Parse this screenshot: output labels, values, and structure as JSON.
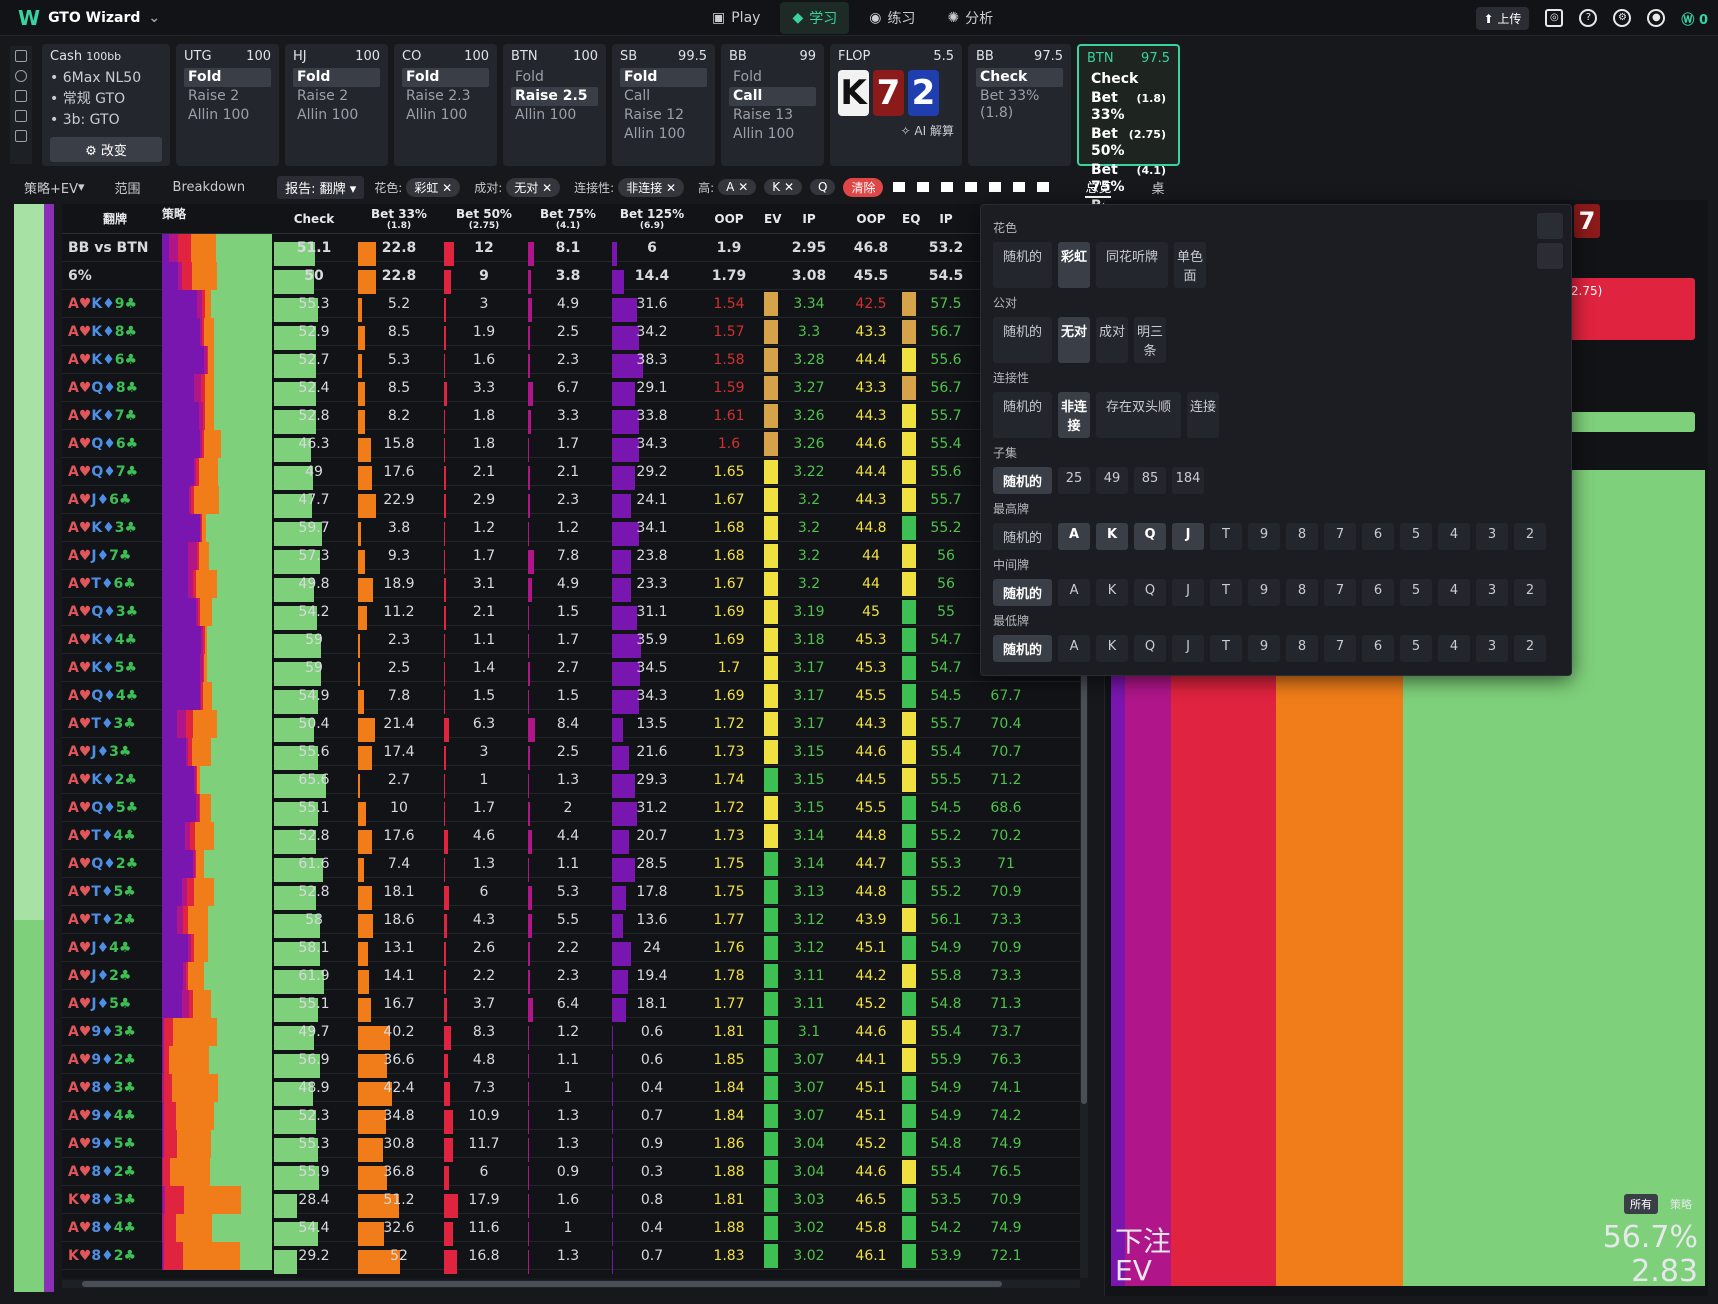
{
  "app": {
    "title": "GTO Wizard"
  },
  "nav": {
    "items": [
      {
        "label": "Play",
        "icon": "cards-icon"
      },
      {
        "label": "学习",
        "icon": "grad-cap-icon",
        "active": true
      },
      {
        "label": "练习",
        "icon": "gamepad-icon"
      },
      {
        "label": "分析",
        "icon": "bulb-icon"
      }
    ]
  },
  "topright": {
    "upload": "上传",
    "coins": "0"
  },
  "positions": [
    {
      "name": "UTG",
      "stack": "100",
      "actions": [
        "Fold",
        "Raise 2",
        "Allin 100"
      ],
      "sel": 0
    },
    {
      "name": "HJ",
      "stack": "100",
      "actions": [
        "Fold",
        "Raise 2",
        "Allin 100"
      ],
      "sel": 0
    },
    {
      "name": "CO",
      "stack": "100",
      "actions": [
        "Fold",
        "Raise 2.3",
        "Allin 100"
      ],
      "sel": 0
    },
    {
      "name": "BTN",
      "stack": "100",
      "actions": [
        "Fold",
        "Raise 2.5",
        "Allin 100"
      ],
      "sel": 1
    },
    {
      "name": "SB",
      "stack": "99.5",
      "actions": [
        "Fold",
        "Call",
        "Raise 12",
        "Allin 100"
      ],
      "sel": 0
    },
    {
      "name": "BB",
      "stack": "99",
      "actions": [
        "Fold",
        "Call",
        "Raise 13",
        "Allin 100"
      ],
      "sel": 1
    }
  ],
  "cash": {
    "title": "Cash",
    "bb": "100bb",
    "lines": [
      "6Max NL50",
      "常规 GTO",
      "3b: GTO"
    ],
    "change": "改变"
  },
  "flop": {
    "label": "FLOP",
    "pot": "5.5",
    "cards": [
      {
        "r": "K",
        "color": "#1a1a1a"
      },
      {
        "r": "7",
        "color": "#8b1a1a"
      },
      {
        "r": "2",
        "color": "#1f3fb0"
      }
    ],
    "ai": "AI 解算"
  },
  "bbcard": {
    "name": "BB",
    "stack": "97.5",
    "actions": [
      "Check",
      "Bet 33%  (1.8)"
    ]
  },
  "btncard": {
    "name": "BTN",
    "stack": "97.5",
    "actions": [
      [
        "Check",
        ""
      ],
      [
        "Bet 33%",
        "(1.8)"
      ],
      [
        "Bet 50%",
        "(2.75)"
      ],
      [
        "Bet 75%",
        "(4.1)"
      ],
      [
        "Bet 125%",
        "(6.9)"
      ]
    ]
  },
  "subbar": {
    "strategy": "策略+EV",
    "range": "范围",
    "breakdown": "Breakdown",
    "report": "报告: 翻牌",
    "suit_label": "花色:",
    "suit_val": "彩虹",
    "pair_label": "成对:",
    "pair_val": "无对",
    "conn_label": "连接性:",
    "conn_val": "非连接",
    "high_label": "高:",
    "high_a": "A",
    "high_k": "K",
    "high_q": "Q",
    "clear": "清除",
    "overview": "总览",
    "table": "桌"
  },
  "table": {
    "headers": [
      "翻牌",
      "策略",
      "Check",
      "Bet 33%",
      "Bet 50%",
      "Bet 75%",
      "Bet 125%",
      "OOP",
      "EV",
      "IP",
      "OOP",
      "EQ",
      "IP"
    ],
    "subheaders": {
      "b33": "(1.8)",
      "b50": "(2.75)",
      "b75": "(4.1)",
      "b125": "(6.9)"
    },
    "summary": [
      {
        "flop": "BB vs BTN",
        "check": "51.1",
        "b33": "22.8",
        "b50": "12",
        "b75": "8.1",
        "b125": "6",
        "oop": "1.9",
        "ip": "2.95",
        "eqoop": "46.8",
        "eqip": "53.2"
      },
      {
        "flop": "6%",
        "check": "50",
        "b33": "22.8",
        "b50": "9",
        "b75": "3.8",
        "b125": "14.4",
        "oop": "1.79",
        "ip": "3.08",
        "eqoop": "45.5",
        "eqip": "54.5"
      }
    ],
    "rows": [
      [
        "A♥K♦9♣",
        "55.3",
        "5.2",
        "3",
        "4.9",
        "31.6",
        "1.54",
        "3.34",
        "42.5",
        "57.5",
        ""
      ],
      [
        "A♥K♦8♣",
        "52.9",
        "8.5",
        "1.9",
        "2.5",
        "34.2",
        "1.57",
        "3.3",
        "43.3",
        "56.7",
        ""
      ],
      [
        "A♥K♦6♣",
        "52.7",
        "5.3",
        "1.6",
        "2.3",
        "38.3",
        "1.58",
        "3.28",
        "44.4",
        "55.6",
        ""
      ],
      [
        "A♥Q♦8♣",
        "52.4",
        "8.5",
        "3.3",
        "6.7",
        "29.1",
        "1.59",
        "3.27",
        "43.3",
        "56.7",
        ""
      ],
      [
        "A♥K♦7♣",
        "52.8",
        "8.2",
        "1.8",
        "3.3",
        "33.8",
        "1.61",
        "3.26",
        "44.3",
        "55.7",
        ""
      ],
      [
        "A♥Q♦6♣",
        "46.3",
        "15.8",
        "1.8",
        "1.7",
        "34.3",
        "1.6",
        "3.26",
        "44.6",
        "55.4",
        ""
      ],
      [
        "A♥Q♦7♣",
        "49",
        "17.6",
        "2.1",
        "2.1",
        "29.2",
        "1.65",
        "3.22",
        "44.4",
        "55.6",
        ""
      ],
      [
        "A♥J♦6♣",
        "47.7",
        "22.9",
        "2.9",
        "2.3",
        "24.1",
        "1.67",
        "3.2",
        "44.3",
        "55.7",
        ""
      ],
      [
        "A♥K♦3♣",
        "59.7",
        "3.8",
        "1.2",
        "1.2",
        "34.1",
        "1.68",
        "3.2",
        "44.8",
        "55.2",
        ""
      ],
      [
        "A♥J♦7♣",
        "57.3",
        "9.3",
        "1.7",
        "7.8",
        "23.8",
        "1.68",
        "3.2",
        "44",
        "56",
        ""
      ],
      [
        "A♥T♦6♣",
        "49.8",
        "18.9",
        "3.1",
        "4.9",
        "23.3",
        "1.67",
        "3.2",
        "44",
        "56",
        ""
      ],
      [
        "A♥Q♦3♣",
        "54.2",
        "11.2",
        "2.1",
        "1.5",
        "31.1",
        "1.69",
        "3.19",
        "45",
        "55",
        ""
      ],
      [
        "A♥K♦4♣",
        "59",
        "2.3",
        "1.1",
        "1.7",
        "35.9",
        "1.69",
        "3.18",
        "45.3",
        "54.7",
        ""
      ],
      [
        "A♥K♦5♣",
        "59",
        "2.5",
        "1.4",
        "2.7",
        "34.5",
        "1.7",
        "3.17",
        "45.3",
        "54.7",
        ""
      ],
      [
        "A♥Q♦4♣",
        "54.9",
        "7.8",
        "1.5",
        "1.5",
        "34.3",
        "1.69",
        "3.17",
        "45.5",
        "54.5",
        "67.7"
      ],
      [
        "A♥T♦3♣",
        "50.4",
        "21.4",
        "6.3",
        "8.4",
        "13.5",
        "1.72",
        "3.17",
        "44.3",
        "55.7",
        "70.4"
      ],
      [
        "A♥J♦3♣",
        "55.6",
        "17.4",
        "3",
        "2.5",
        "21.6",
        "1.73",
        "3.15",
        "44.6",
        "55.4",
        "70.7"
      ],
      [
        "A♥K♦2♣",
        "65.6",
        "2.7",
        "1",
        "1.3",
        "29.3",
        "1.74",
        "3.15",
        "44.5",
        "55.5",
        "71.2"
      ],
      [
        "A♥Q♦5♣",
        "55.1",
        "10",
        "1.7",
        "2",
        "31.2",
        "1.72",
        "3.15",
        "45.5",
        "54.5",
        "68.6"
      ],
      [
        "A♥T♦4♣",
        "52.8",
        "17.6",
        "4.6",
        "4.4",
        "20.7",
        "1.73",
        "3.14",
        "44.8",
        "55.2",
        "70.2"
      ],
      [
        "A♥Q♦2♣",
        "61.6",
        "7.4",
        "1.3",
        "1.1",
        "28.5",
        "1.75",
        "3.14",
        "44.7",
        "55.3",
        "71"
      ],
      [
        "A♥T♦5♣",
        "52.8",
        "18.1",
        "6",
        "5.3",
        "17.8",
        "1.75",
        "3.13",
        "44.8",
        "55.2",
        "70.9"
      ],
      [
        "A♥T♦2♣",
        "58",
        "18.6",
        "4.3",
        "5.5",
        "13.6",
        "1.77",
        "3.12",
        "43.9",
        "56.1",
        "73.3"
      ],
      [
        "A♥J♦4♣",
        "58.1",
        "13.1",
        "2.6",
        "2.2",
        "24",
        "1.76",
        "3.12",
        "45.1",
        "54.9",
        "70.9"
      ],
      [
        "A♥J♦2♣",
        "61.9",
        "14.1",
        "2.2",
        "2.3",
        "19.4",
        "1.78",
        "3.11",
        "44.2",
        "55.8",
        "73.3"
      ],
      [
        "A♥J♦5♣",
        "55.1",
        "16.7",
        "3.7",
        "6.4",
        "18.1",
        "1.77",
        "3.11",
        "45.2",
        "54.8",
        "71.3"
      ],
      [
        "A♥9♦3♣",
        "49.7",
        "40.2",
        "8.3",
        "1.2",
        "0.6",
        "1.81",
        "3.1",
        "44.6",
        "55.4",
        "73.7"
      ],
      [
        "A♥9♦2♣",
        "56.9",
        "36.6",
        "4.8",
        "1.1",
        "0.6",
        "1.85",
        "3.07",
        "44.1",
        "55.9",
        "76.3"
      ],
      [
        "A♥8♦3♣",
        "48.9",
        "42.4",
        "7.3",
        "1",
        "0.4",
        "1.84",
        "3.07",
        "45.1",
        "54.9",
        "74.1"
      ],
      [
        "A♥9♦4♣",
        "52.3",
        "34.8",
        "10.9",
        "1.3",
        "0.7",
        "1.84",
        "3.07",
        "45.1",
        "54.9",
        "74.2"
      ],
      [
        "A♥9♦5♣",
        "55.3",
        "30.8",
        "11.7",
        "1.3",
        "0.9",
        "1.86",
        "3.04",
        "45.2",
        "54.8",
        "74.9"
      ],
      [
        "A♥8♦2♣",
        "55.9",
        "36.8",
        "6",
        "0.9",
        "0.3",
        "1.88",
        "3.04",
        "44.6",
        "55.4",
        "76.5"
      ],
      [
        "K♥8♦3♣",
        "28.4",
        "51.2",
        "17.9",
        "1.6",
        "0.8",
        "1.81",
        "3.03",
        "46.5",
        "53.5",
        "70.9"
      ],
      [
        "A♥8♦4♣",
        "54.4",
        "32.6",
        "11.6",
        "1",
        "0.4",
        "1.88",
        "3.02",
        "45.8",
        "54.2",
        "74.9"
      ],
      [
        "K♥8♦2♣",
        "29.2",
        "52",
        "16.8",
        "1.3",
        "0.7",
        "1.83",
        "3.02",
        "46.1",
        "53.9",
        "72.1"
      ]
    ]
  },
  "dropdown": {
    "sections": [
      {
        "title": "花色",
        "opts": [
          "随机的",
          "彩虹",
          "同花听牌",
          "单色面"
        ],
        "sel": 1
      },
      {
        "title": "公对",
        "opts": [
          "随机的",
          "无对",
          "成对",
          "明三条"
        ],
        "sel": 1
      },
      {
        "title": "连接性",
        "opts": [
          "随机的",
          "非连接",
          "存在双头顺",
          "连接"
        ],
        "sel": 1
      },
      {
        "title": "子集",
        "opts": [
          "随机的",
          "25",
          "49",
          "85",
          "184"
        ],
        "sel": 0
      },
      {
        "title": "最高牌",
        "opts": [
          "随机的",
          "A",
          "K",
          "Q",
          "J",
          "T",
          "9",
          "8",
          "7",
          "6",
          "5",
          "4",
          "3",
          "2"
        ],
        "selset": [
          1,
          2,
          3,
          4
        ]
      },
      {
        "title": "中间牌",
        "opts": [
          "随机的",
          "A",
          "K",
          "Q",
          "J",
          "T",
          "9",
          "8",
          "7",
          "6",
          "5",
          "4",
          "3",
          "2"
        ],
        "selset": [
          0
        ]
      },
      {
        "title": "最低牌",
        "opts": [
          "随机的",
          "A",
          "K",
          "Q",
          "J",
          "T",
          "9",
          "8",
          "7",
          "6",
          "5",
          "4",
          "3",
          "2"
        ],
        "selset": [
          0
        ]
      }
    ]
  },
  "rightpane": {
    "card": "7",
    "bet_label": "% (2.75)",
    "all": "所有",
    "strat": "策略",
    "pct": "56.7%",
    "ev": "2.83",
    "bet_word": "下注",
    "ev_word": "EV",
    "shares": [
      0.08,
      0.18,
      0.22,
      0.52
    ]
  },
  "colors": {
    "check": "#7ed07a",
    "b33": "#f07d1a",
    "b50": "#e0233f",
    "b75": "#b0168a",
    "b125": "#7a16b0",
    "accent": "#38d39f"
  }
}
